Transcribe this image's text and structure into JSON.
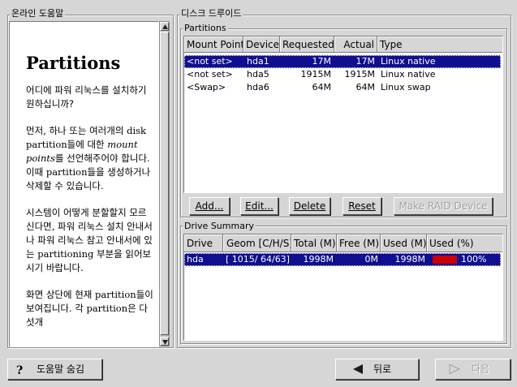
{
  "help_panel": {
    "title": "온라인 도움말",
    "heading": "Partitions",
    "p1": "어디에 파워 리눅스를 설치하기 원하십니까?",
    "p2a": "먼저, 하나 또는 여러개의",
    "p2_disk": "disk partition",
    "p2b": "들에 대한",
    "p2_mount": "mount points",
    "p2c": "를",
    "p2d": "선언해주어야 합니다. 이때",
    "p2_part": "partition",
    "p2e": "들을 생성하거나 삭제할 수 있습니다.",
    "p3a": "시스템이 어떻게 분할할지 모르신다면, 파워 리눅스 설치 안내서나 파워 리눅스 참고 안내서에 있는",
    "p3_part": "partitioning",
    "p3b": "부분을 읽어보시기 바랍니다.",
    "p4a": "화면 상단에 현재",
    "p4_part": "partition",
    "p4b": "들이 보여집니다.",
    "p4c": "각",
    "p4_part2": "partition",
    "p4d": "은 다섯개"
  },
  "disk_druid": {
    "title": "디스크 드루이드",
    "partitions": {
      "label": "Partitions",
      "columns": [
        "Mount Point",
        "Device",
        "Requested",
        "Actual",
        "Type"
      ],
      "rows": [
        {
          "mount": "<not set>",
          "device": "hda1",
          "requested": "17M",
          "actual": "17M",
          "type": "Linux native",
          "selected": true
        },
        {
          "mount": "<not set>",
          "device": "hda5",
          "requested": "1915M",
          "actual": "1915M",
          "type": "Linux native",
          "selected": false
        },
        {
          "mount": "<Swap>",
          "device": "hda6",
          "requested": "64M",
          "actual": "64M",
          "type": "Linux swap",
          "selected": false
        }
      ],
      "buttons": {
        "add": "Add...",
        "edit": "Edit...",
        "delete": "Delete",
        "reset": "Reset",
        "make_raid": "Make RAID Device"
      }
    },
    "drive_summary": {
      "label": "Drive Summary",
      "columns": [
        "Drive",
        "Geom [C/H/S]",
        "Total (M)",
        "Free (M)",
        "Used (M)",
        "Used (%)"
      ],
      "rows": [
        {
          "drive": "hda",
          "geom": "[ 1015/ 64/63]",
          "total": "1998M",
          "free": "0M",
          "used": "1998M",
          "used_pct_label": "100%",
          "used_fraction": 1.0
        }
      ]
    }
  },
  "footer": {
    "hide_help": "도움말 숨김",
    "back": "뒤로",
    "next": "다음"
  },
  "colors": {
    "selection": "#0f0f8f",
    "usage_bar": "#cc0000",
    "window_bg": "#d6d6d6"
  }
}
